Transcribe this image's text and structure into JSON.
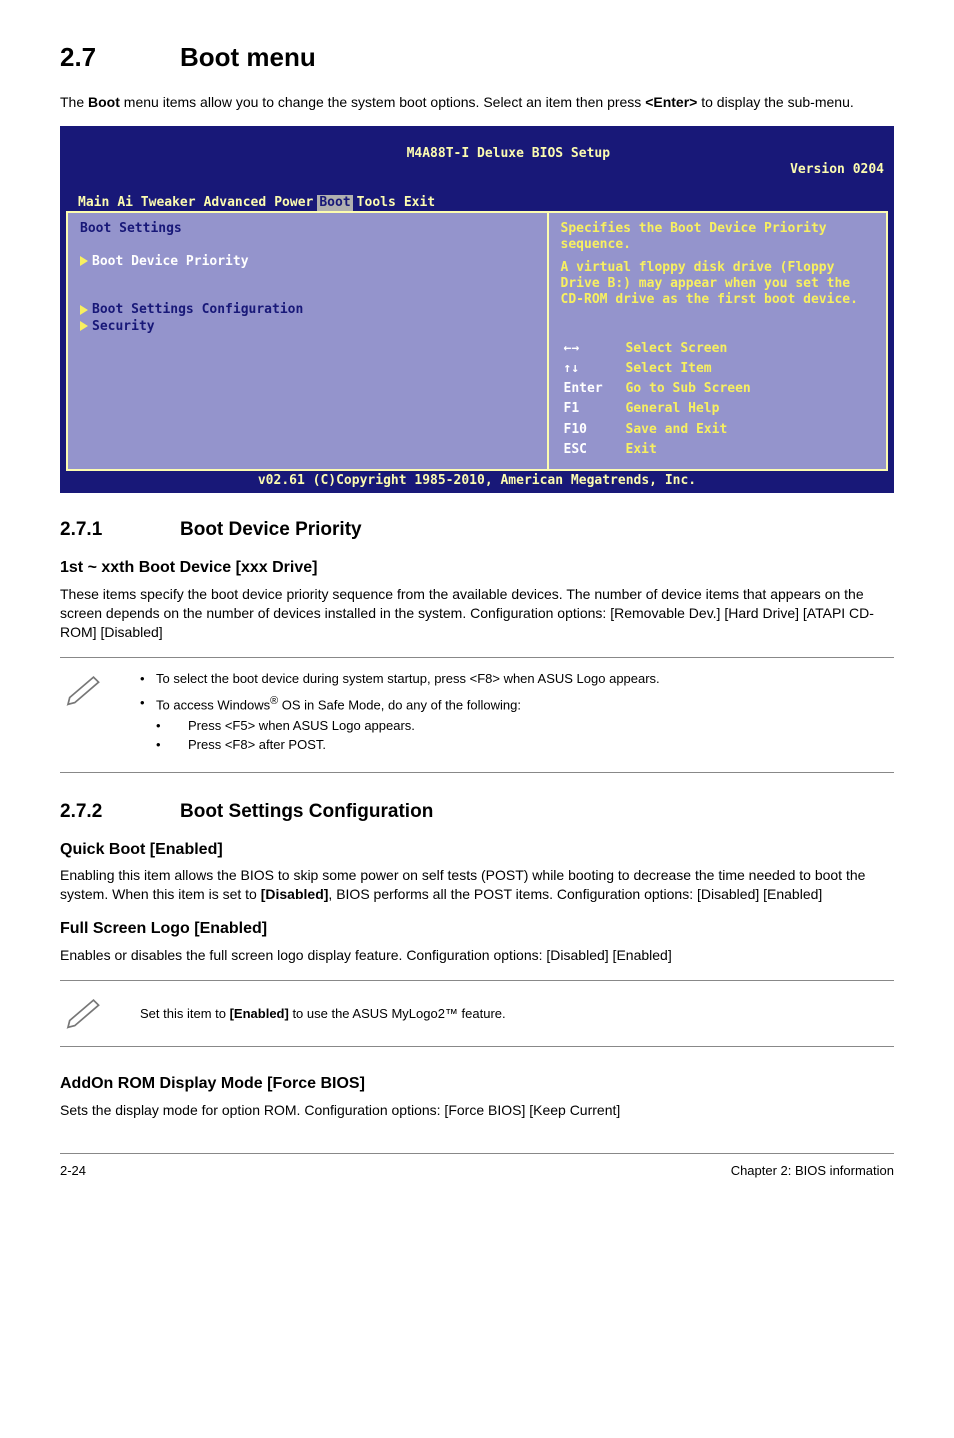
{
  "section": {
    "num": "2.7",
    "title": "Boot menu",
    "intro_pre": "The ",
    "intro_bold1": "Boot",
    "intro_mid": " menu items allow you to change the system boot options. Select an item then press ",
    "intro_bold2": "<Enter>",
    "intro_post": " to display the sub-menu."
  },
  "bios": {
    "title": "M4A88T-I Deluxe BIOS Setup",
    "version": "Version 0204",
    "tabs": [
      "Main",
      "Ai Tweaker",
      "Advanced",
      "Power",
      "Boot",
      "Tools",
      "Exit"
    ],
    "active_tab_index": 4,
    "panel_heading": "Boot Settings",
    "items": {
      "boot_device_priority": "Boot Device Priority",
      "boot_settings_conf": "Boot Settings Configuration",
      "security": "Security"
    },
    "help_block1": "Specifies the Boot Device Priority sequence.",
    "help_block2": "A virtual floppy disk drive (Floppy Drive B:) may appear when you set the CD-ROM drive as the first boot device.",
    "legend": {
      "select_screen": "Select Screen",
      "select_item": "Select Item",
      "enter_key": "Enter",
      "enter_label": "Go to Sub Screen",
      "f1_key": "F1",
      "f1_label": "General Help",
      "f10_key": "F10",
      "f10_label": "Save and Exit",
      "esc_key": "ESC",
      "esc_label": "Exit"
    },
    "footer": "v02.61 (C)Copyright 1985-2010, American Megatrends, Inc."
  },
  "s271": {
    "num": "2.7.1",
    "title": "Boot Device Priority",
    "item_heading": "1st ~ xxth Boot Device [xxx Drive]",
    "para": "These items specify the boot device priority sequence from the available devices. The number of device items that appears on the screen depends on the number of devices installed in the system. Configuration options: [Removable Dev.] [Hard Drive] [ATAPI CD-ROM] [Disabled]"
  },
  "note1": {
    "b1": "To select the boot device during system startup, press <F8> when ASUS Logo appears.",
    "b2_pre": "To access Windows",
    "b2_reg": "®",
    "b2_post": " OS in Safe Mode, do any of the following:",
    "b2_s1": "Press <F5> when ASUS Logo appears.",
    "b2_s2": "Press <F8> after POST."
  },
  "s272": {
    "num": "2.7.2",
    "title": "Boot Settings Configuration",
    "quick_head": "Quick Boot [Enabled]",
    "quick_para_pre": "Enabling this item allows the BIOS to skip some power on self tests (POST) while booting to decrease the time needed to boot the system. When this item is set to ",
    "quick_para_bold": "[Disabled]",
    "quick_para_post": ", BIOS performs all the POST items. Configuration options: [Disabled] [Enabled]",
    "full_head": "Full Screen Logo [Enabled]",
    "full_para": "Enables or disables the full screen logo display feature. Configuration options: [Disabled] [Enabled]"
  },
  "note2": {
    "text_pre": "Set this item to ",
    "text_bold": "[Enabled]",
    "text_post": " to use the ASUS MyLogo2™ feature."
  },
  "addon": {
    "head": "AddOn ROM Display Mode [Force BIOS]",
    "para": "Sets the display mode for option ROM. Configuration options: [Force BIOS] [Keep Current]"
  },
  "footer": {
    "left": "2-24",
    "right": "Chapter 2: BIOS information"
  }
}
